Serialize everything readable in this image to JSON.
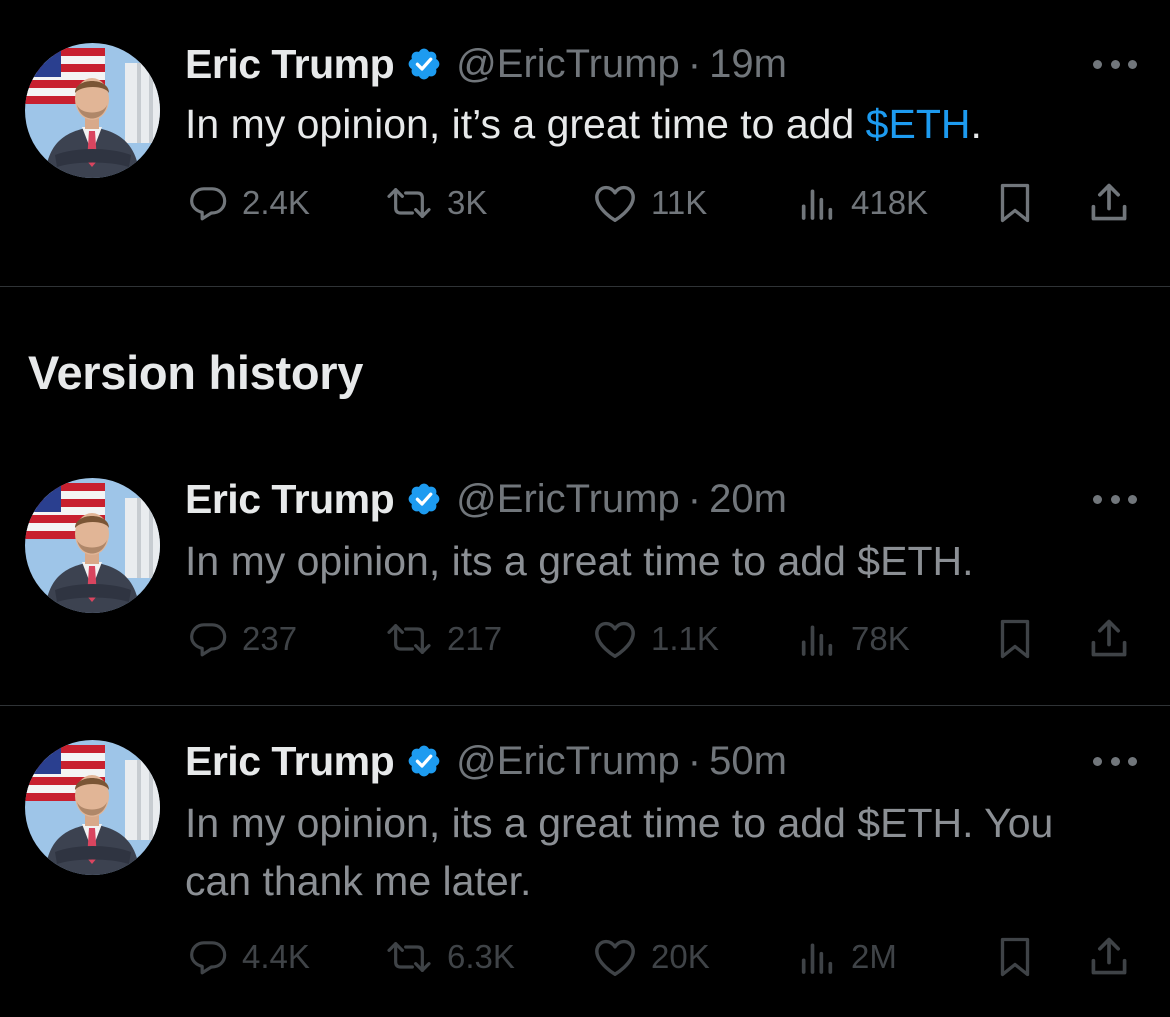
{
  "current_tweet": {
    "name": "Eric Trump",
    "handle": "@EricTrump",
    "separator": "·",
    "time": "19m",
    "text_before": "In my opinion, it’s a great time to add ",
    "cashtag": "$ETH",
    "text_after": ".",
    "replies": "2.4K",
    "reposts": "3K",
    "likes": "11K",
    "views": "418K"
  },
  "version_history": {
    "title": "Version history",
    "versions": [
      {
        "name": "Eric Trump",
        "handle": "@EricTrump",
        "separator": "·",
        "time": "20m",
        "text": "In my opinion, its a great time to add $ETH.",
        "replies": "237",
        "reposts": "217",
        "likes": "1.1K",
        "views": "78K"
      },
      {
        "name": "Eric Trump",
        "handle": "@EricTrump",
        "separator": "·",
        "time": "50m",
        "text_line1": "In my opinion, its a great time to add $ETH. You",
        "text_line2": "can thank me later.",
        "replies": "4.4K",
        "reposts": "6.3K",
        "likes": "20K",
        "views": "2M"
      }
    ]
  },
  "icons": [
    "reply-icon",
    "repost-icon",
    "like-icon",
    "views-icon",
    "bookmark-icon",
    "share-icon",
    "more-icon",
    "verified-badge-icon"
  ],
  "colors": {
    "background": "#000000",
    "text": "#e7e9ea",
    "muted": "#71767b",
    "accent": "#1d9bf0",
    "divider": "#2f3336"
  }
}
